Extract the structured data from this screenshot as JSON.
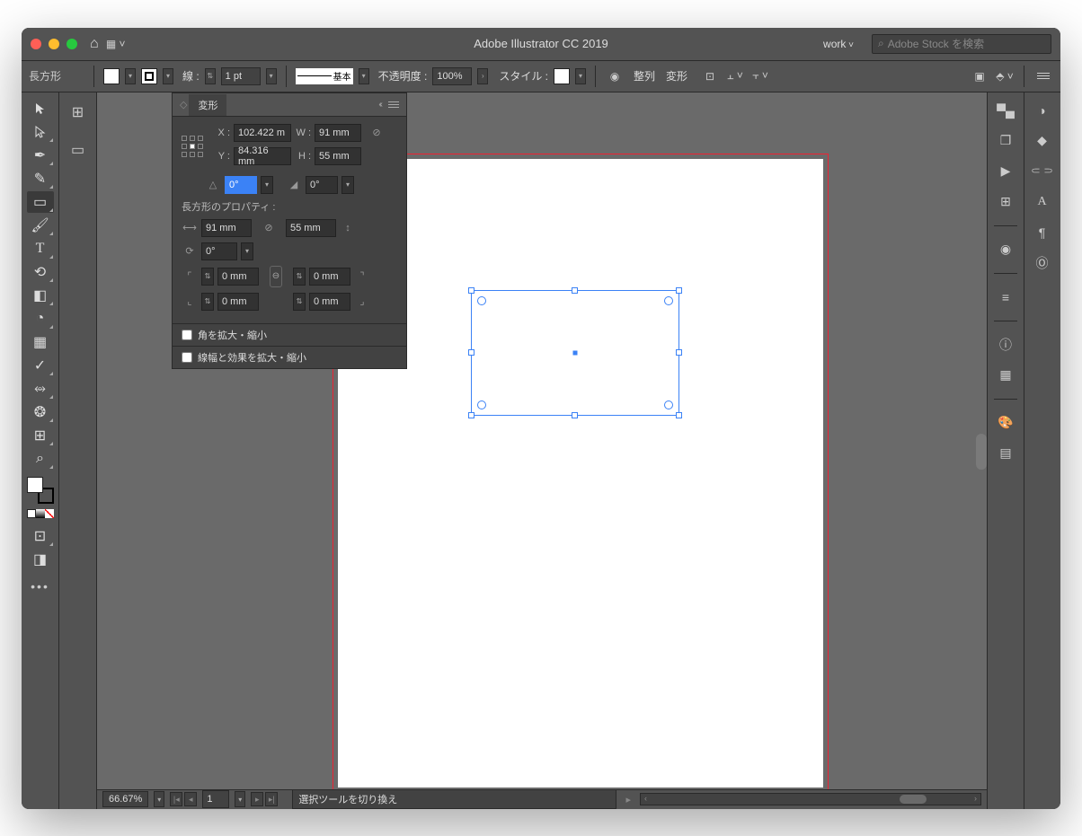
{
  "titlebar": {
    "title": "Adobe Illustrator CC 2019",
    "workspace": "work",
    "search_placeholder": "Adobe Stock を検索"
  },
  "controlbar": {
    "shape": "長方形",
    "stroke_label": "線 :",
    "stroke_weight": "1 pt",
    "stroke_profile": "基本",
    "opacity_label": "不透明度 :",
    "opacity_value": "100%",
    "style_label": "スタイル :",
    "align_label": "整列",
    "transform_label": "変形"
  },
  "transform_panel": {
    "title": "変形",
    "x_label": "X :",
    "x_value": "102.422 m",
    "y_label": "Y :",
    "y_value": "84.316 mm",
    "w_label": "W :",
    "w_value": "91 mm",
    "h_label": "H :",
    "h_value": "55 mm",
    "angle_value": "0°",
    "shear_value": "0°",
    "props_label": "長方形のプロパティ :",
    "rect_w": "91 mm",
    "rect_h": "55 mm",
    "rect_angle": "0°",
    "corner_tl": "0 mm",
    "corner_tr": "0 mm",
    "corner_bl": "0 mm",
    "corner_br": "0 mm",
    "scale_corners": "角を拡大・縮小",
    "scale_strokes": "線幅と効果を拡大・縮小"
  },
  "statusbar": {
    "zoom": "66.67%",
    "page": "1",
    "hint": "選択ツールを切り換え"
  }
}
